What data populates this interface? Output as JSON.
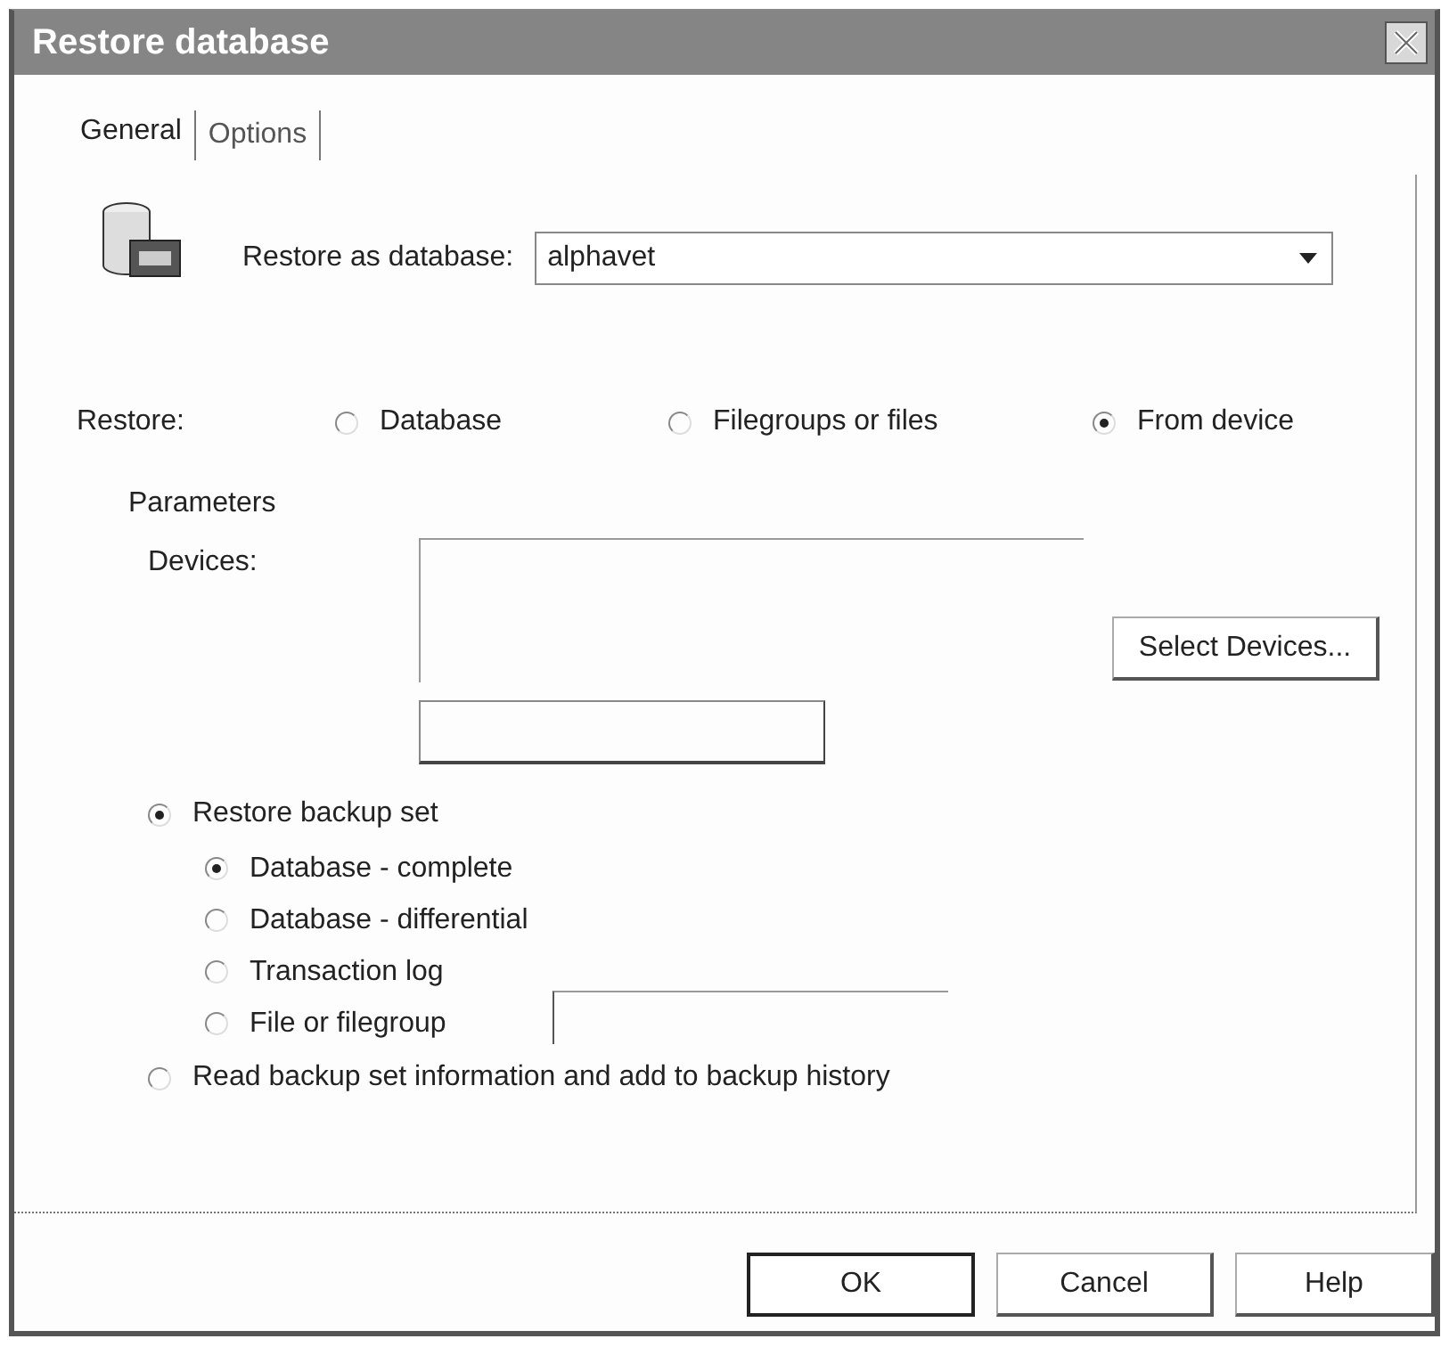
{
  "window": {
    "title": "Restore database"
  },
  "tabs": [
    {
      "label": "General",
      "selected": true
    },
    {
      "label": "Options",
      "selected": false
    }
  ],
  "restore_as": {
    "label": "Restore as database:",
    "value": "alphavet"
  },
  "restore_type": {
    "label": "Restore:",
    "options": [
      {
        "label": "Database",
        "selected": false
      },
      {
        "label": "Filegroups or files",
        "selected": false
      },
      {
        "label": "From device",
        "selected": true
      }
    ]
  },
  "parameters": {
    "heading": "Parameters",
    "devices_label": "Devices:",
    "select_button": "Select Devices..."
  },
  "backup_options": [
    {
      "label": "Restore backup set",
      "selected": true,
      "children": [
        {
          "label": "Database - complete",
          "selected": true,
          "kind": "radio"
        },
        {
          "label": "Database - differential",
          "selected": false,
          "kind": "radio"
        },
        {
          "label": "Transaction log",
          "selected": false,
          "kind": "radio"
        },
        {
          "label": "File or filegroup",
          "selected": false,
          "kind": "radio-field"
        }
      ]
    },
    {
      "label": "Read backup set information and add to backup history",
      "selected": false
    }
  ],
  "buttons": [
    {
      "label": "OK",
      "default": true
    },
    {
      "label": "Cancel",
      "default": false
    },
    {
      "label": "Help",
      "default": false
    }
  ]
}
